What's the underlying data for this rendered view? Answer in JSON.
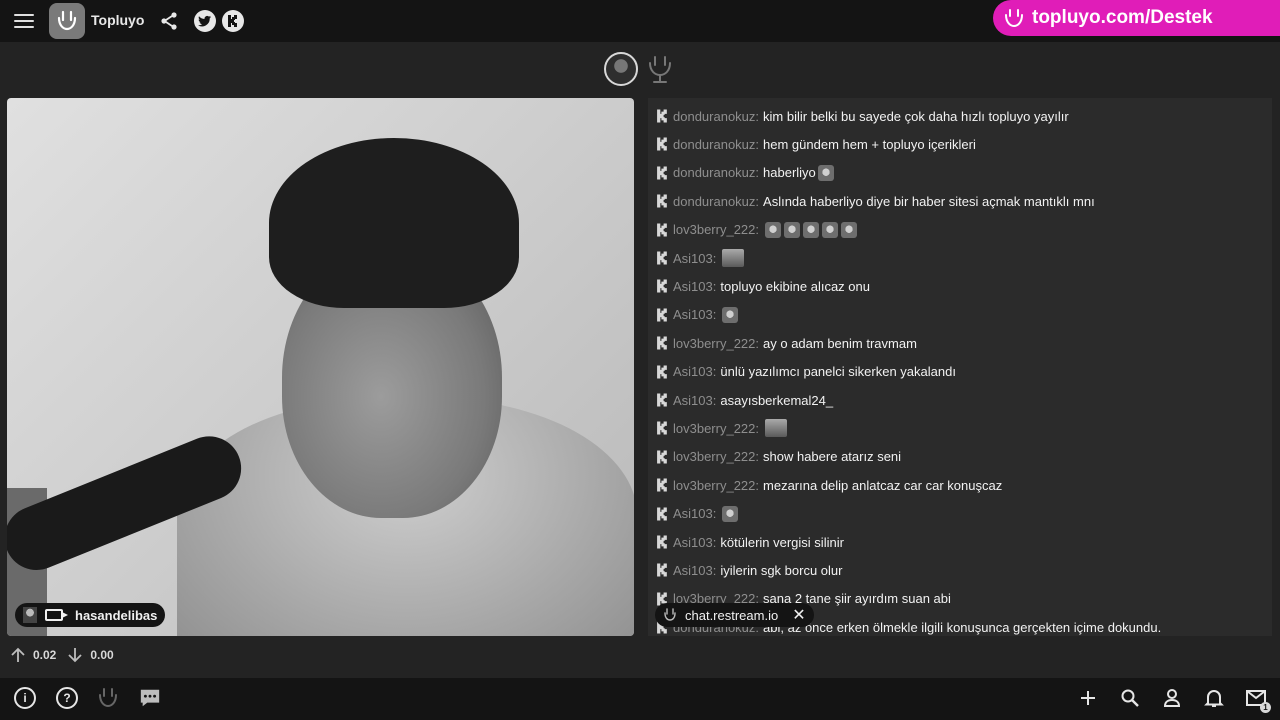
{
  "header": {
    "title": "Topluyo",
    "support_banner": "topluyo.com/Destek"
  },
  "stream": {
    "streamer_name": "hasandelibas"
  },
  "chat": {
    "source": "chat.restream.io",
    "messages": [
      {
        "user": "donduranokuz",
        "text": "kim bilir belki bu sayede çok daha hızlı topluyo yayılır",
        "emotes": 0
      },
      {
        "user": "donduranokuz",
        "text": "hem gündem hem + topluyo içerikleri",
        "emotes": 0
      },
      {
        "user": "donduranokuz",
        "text": "haberliyo",
        "emotes": 1
      },
      {
        "user": "donduranokuz",
        "text": "Aslında haberliyo diye bir haber sitesi açmak mantıklı mnı",
        "emotes": 0
      },
      {
        "user": "lov3berry_222",
        "text": "",
        "emotes": 5
      },
      {
        "user": "Asi103",
        "text": "",
        "emotes": 1,
        "wide": true
      },
      {
        "user": "Asi103",
        "text": "topluyo ekibine alıcaz onu",
        "emotes": 0
      },
      {
        "user": "Asi103",
        "text": "",
        "emotes": 1
      },
      {
        "user": "lov3berry_222",
        "text": "ay o adam benim travmam",
        "emotes": 0
      },
      {
        "user": "Asi103",
        "text": "ünlü yazılımcı panelci sikerken yakalandı",
        "emotes": 0
      },
      {
        "user": "Asi103",
        "text": "asayısberkemal24_",
        "emotes": 0
      },
      {
        "user": "lov3berry_222",
        "text": "",
        "emotes": 1,
        "wide": true
      },
      {
        "user": "lov3berry_222",
        "text": "show habere atarız seni",
        "emotes": 0
      },
      {
        "user": "lov3berry_222",
        "text": "mezarına delip anlatcaz car car konuşcaz",
        "emotes": 0
      },
      {
        "user": "Asi103",
        "text": "",
        "emotes": 1
      },
      {
        "user": "Asi103",
        "text": "kötülerin vergisi silinir",
        "emotes": 0
      },
      {
        "user": "Asi103",
        "text": "iyilerin sgk borcu olur",
        "emotes": 0
      },
      {
        "user": "lov3berry_222",
        "text": "sana 2 tane şiir ayırdım suan abi",
        "emotes": 0
      },
      {
        "user": "donduranokuz",
        "text": "abi, az önce erken ölmekle ilgili konuşunca gerçekten içime dokundu.",
        "emotes": 0
      }
    ]
  },
  "votes": {
    "up": "0.02",
    "down": "0.00"
  },
  "bottombar": {
    "info_icon": "i",
    "help_icon": "?",
    "mail_badge": "1"
  },
  "colors": {
    "accent": "#e01db8",
    "background": "#232323",
    "bar": "#141414",
    "chat_bg": "#2b2b2b",
    "username": "#8e8e8e"
  },
  "icons": [
    "menu-icon",
    "logo-icon",
    "share-icon",
    "twitter-icon",
    "kick-icon",
    "info-icon",
    "help-icon",
    "topluyo-icon",
    "chat-icon",
    "plus-icon",
    "search-icon",
    "user-icon",
    "bell-icon",
    "mail-icon",
    "close-icon",
    "camera-icon",
    "arrow-up-icon",
    "arrow-down-icon"
  ]
}
